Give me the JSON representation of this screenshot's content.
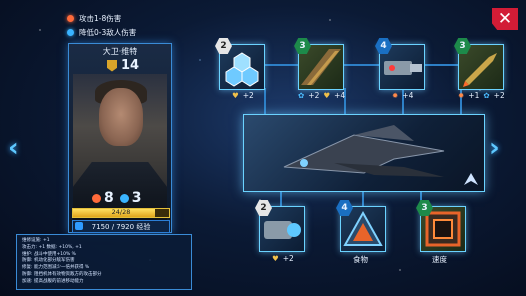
{
  "bonuses": [
    {
      "text": "攻击1-8伤害",
      "icon": "attack-icon"
    },
    {
      "text": "降低0-3敌人伤害",
      "icon": "shield-icon"
    }
  ],
  "pilot": {
    "name": "大卫·维特",
    "rank": "14",
    "attack": "8",
    "defense": "3",
    "hp_text": "24/28",
    "hp_fraction": 0.857,
    "xp_text": "7150 / 7920 经验"
  },
  "info_lines": [
    "维修设施: +1 ",
    "攻击力: +1 数据: +10%, +1",
    "维护: 战斗中使用+10% %",
    "防御: 机动化部分敌军伤害",
    "修复: 能力范围减少一倍并获得 %",
    "防御: 阻挡机体有效物资敌方的攻击部分",
    "加速: 提高战舰的前进移动能力"
  ],
  "top_slots": [
    {
      "level": "2",
      "bonus": [
        "+2"
      ],
      "icons": [
        "heart-icon"
      ]
    },
    {
      "level": "3",
      "bonus": [
        "+2",
        "+4"
      ],
      "icons": [
        "gem-icon",
        "heart-icon"
      ]
    },
    {
      "level": "4",
      "bonus": [
        "+4"
      ],
      "icons": [
        "skull-icon"
      ]
    },
    {
      "level": "3",
      "bonus": [
        "+1",
        "+2"
      ],
      "icons": [
        "skull-icon",
        "gem-icon"
      ]
    }
  ],
  "bottom_slots": [
    {
      "level": "2",
      "bonus": "+2",
      "label": ""
    },
    {
      "level": "4",
      "bonus": "",
      "label": "食物"
    },
    {
      "level": "3",
      "bonus": "",
      "label": "速度"
    }
  ]
}
